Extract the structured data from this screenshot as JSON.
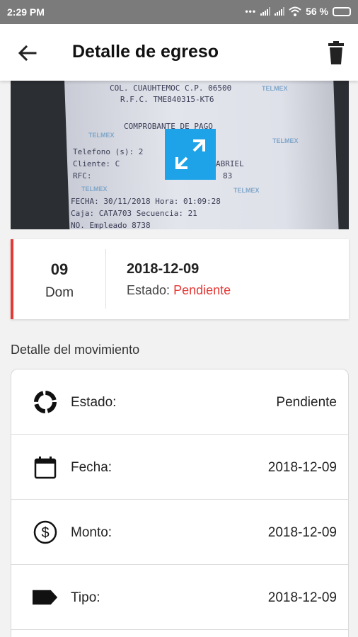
{
  "status_bar": {
    "time": "2:29 PM",
    "battery_percent": "56 %",
    "battery_level": 0.56
  },
  "app_bar": {
    "title": "Detalle de egreso",
    "back_icon": "arrow-left-icon",
    "delete_icon": "trash-icon"
  },
  "receipt": {
    "lines": [
      "COL. CUAUHTEMOC C.P. 06500",
      "R.F.C.  TME840315-KT6",
      "COMPROBANTE DE PAGO",
      "Telefono (s):  2",
      "Cliente:       C",
      "RFC:",
      "FECHA: 30/11/2018 Hora: 01:09:28",
      "Caja: CATA703   Secuencia: 21",
      "NO. Empleado   8738"
    ],
    "fragments": [
      "ABRIEL",
      "83"
    ],
    "watermark": "TELMEX",
    "expand_icon": "expand-icon"
  },
  "date_card": {
    "day": "09",
    "weekday": "Dom",
    "date": "2018-12-09",
    "estado_label": "Estado:",
    "estado_value": "Pendiente"
  },
  "section_title": "Detalle del movimiento",
  "details": [
    {
      "icon": "status-cycle-icon",
      "label": "Estado:",
      "value": "Pendiente"
    },
    {
      "icon": "calendar-icon",
      "label": "Fecha:",
      "value": "2018-12-09"
    },
    {
      "icon": "dollar-icon",
      "label": "Monto:",
      "value": "2018-12-09"
    },
    {
      "icon": "tag-icon",
      "label": "Tipo:",
      "value": "2018-12-09"
    }
  ],
  "colors": {
    "accent_red": "#e53935",
    "expand_blue": "#1ea3e8",
    "status_bar": "#7b7b7b"
  }
}
